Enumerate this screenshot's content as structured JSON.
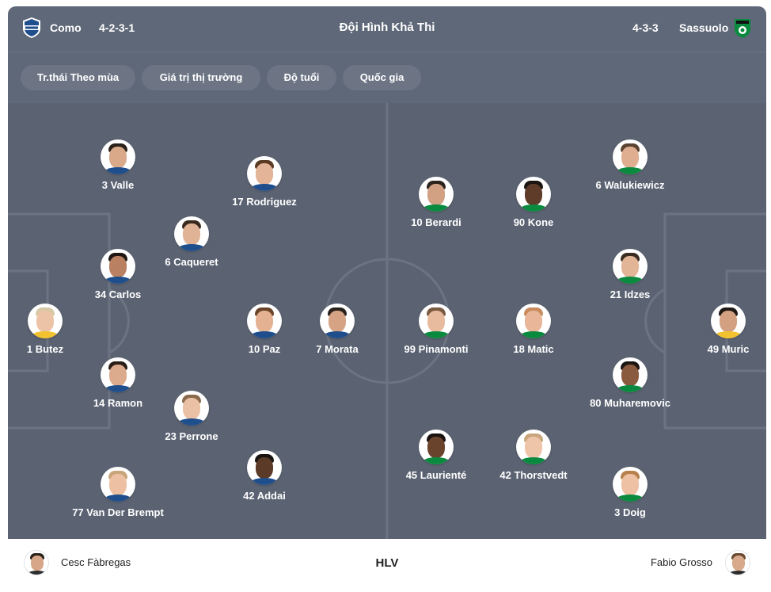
{
  "header": {
    "home_team": "Como",
    "home_formation": "4-2-3-1",
    "title": "Đội Hình Khả Thi",
    "away_formation": "4-3-3",
    "away_team": "Sassuolo",
    "home_logo_icon": "como-crest-icon",
    "away_logo_icon": "sassuolo-crest-icon"
  },
  "tabs": [
    {
      "label": "Tr.thái Theo mùa"
    },
    {
      "label": "Giá trị thị trường"
    },
    {
      "label": "Độ tuổi"
    },
    {
      "label": "Quốc gia"
    }
  ],
  "home_players": [
    {
      "label": "3 Valle"
    },
    {
      "label": "17 Rodriguez"
    },
    {
      "label": "6 Caqueret"
    },
    {
      "label": "34 Carlos"
    },
    {
      "label": "1 Butez"
    },
    {
      "label": "10 Paz"
    },
    {
      "label": "7 Morata"
    },
    {
      "label": "14 Ramon"
    },
    {
      "label": "23 Perrone"
    },
    {
      "label": "42 Addai"
    },
    {
      "label": "77 Van Der Brempt"
    }
  ],
  "away_players": [
    {
      "label": "6 Walukiewicz"
    },
    {
      "label": "10 Berardi"
    },
    {
      "label": "90 Kone"
    },
    {
      "label": "21 Idzes"
    },
    {
      "label": "99 Pinamonti"
    },
    {
      "label": "18 Matic"
    },
    {
      "label": "49 Muric"
    },
    {
      "label": "80 Muharemovic"
    },
    {
      "label": "45 Laurienté"
    },
    {
      "label": "42 Thorstvedt"
    },
    {
      "label": "3 Doig"
    }
  ],
  "footer": {
    "home_coach": "Cesc Fàbregas",
    "coach_label": "HLV",
    "away_coach": "Fabio Grosso"
  },
  "colors": {
    "header_bg": "#5f6878",
    "pitch_bg": "#5b6372",
    "pitch_lines": "#6c7483",
    "tab_bg": "#6d7585",
    "como_blue": "#1f4e8c",
    "sassuolo_green": "#0a8a3e"
  }
}
